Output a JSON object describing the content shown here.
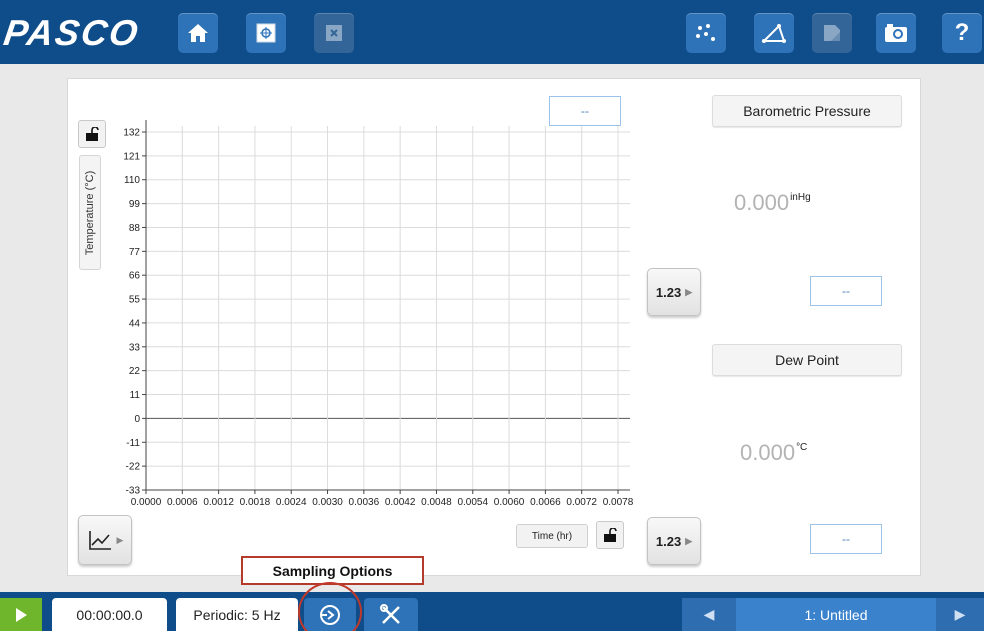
{
  "app": {
    "logo_text": "PASCO"
  },
  "toolbar": {
    "help_label": "?"
  },
  "graph": {
    "y_axis_label": "Temperature (°C)",
    "x_axis_label": "Time (hr)",
    "top_value_box": "--",
    "y_ticks": [
      "132",
      "121",
      "110",
      "99",
      "88",
      "77",
      "66",
      "55",
      "44",
      "33",
      "22",
      "11",
      "0",
      "-11",
      "-22",
      "-33"
    ],
    "x_ticks": [
      "0.0000",
      "0.0006",
      "0.0012",
      "0.0018",
      "0.0024",
      "0.0030",
      "0.0036",
      "0.0042",
      "0.0048",
      "0.0054",
      "0.0060",
      "0.0066",
      "0.0072",
      "0.0078"
    ]
  },
  "displays": [
    {
      "title": "Barometric Pressure",
      "value": "0.000",
      "unit": "inHg",
      "box": "--",
      "button": "1.23"
    },
    {
      "title": "Dew Point",
      "value": "0.000",
      "unit": "°C",
      "box": "--",
      "button": "1.23"
    }
  ],
  "callout": {
    "label": "Sampling Options"
  },
  "bottombar": {
    "elapsed_time": "00:00:00.0",
    "sampling_rate": "Periodic: 5 Hz",
    "page_name": "1: Untitled"
  },
  "colors": {
    "bar": "#0f4d8a",
    "button": "#2e72b8",
    "play": "#6fb62c",
    "callout_border": "#b43a2b"
  }
}
